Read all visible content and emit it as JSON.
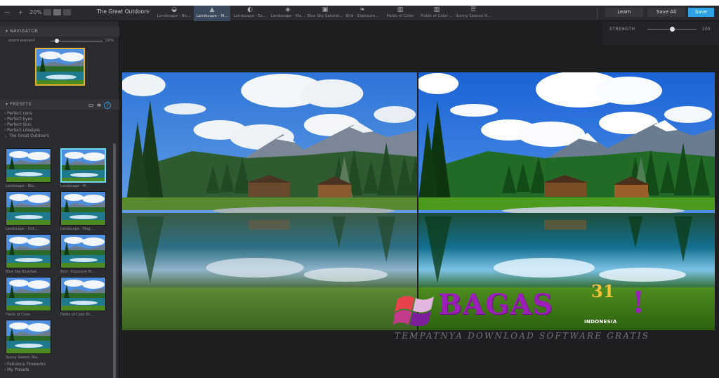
{
  "toolbar": {
    "zoom_out": "—",
    "zoom_in": "+",
    "zoom_value": "20%",
    "preset_name": "The Great Outdoors",
    "tabs": [
      {
        "label": "Landscape - Blu...",
        "icon": "eye-icon"
      },
      {
        "label": "Landscape - M...",
        "icon": "mountain-icon"
      },
      {
        "label": "Landscape - Ex...",
        "icon": "sun-icon"
      },
      {
        "label": "Landscape - Ma...",
        "icon": "compass-icon"
      },
      {
        "label": "Blue Sky Saturat...",
        "icon": "camera-icon"
      },
      {
        "label": "Bird - Exposure...",
        "icon": "leaf-icon"
      },
      {
        "label": "Fields of Color",
        "icon": "chart-icon"
      },
      {
        "label": "Fields of Color ...",
        "icon": "chart-icon"
      },
      {
        "label": "Sunny Season B...",
        "icon": "sliders-icon"
      }
    ],
    "learn_label": "Learn",
    "save_all_label": "Save All",
    "save_label": "Save"
  },
  "strength": {
    "label": "STRENGTH",
    "value": "100"
  },
  "navigator": {
    "title": "NAVIGATOR",
    "zoom_label": "zoom percent",
    "zoom_value": "20%"
  },
  "presets": {
    "title": "PRESETS",
    "groups": [
      "Perfect Lens",
      "Perfect Eyes",
      "Perfect Skin",
      "Perfect Lifestyle",
      "The Great Outdoors"
    ],
    "tiles": [
      "Landscape - Blu...",
      "Landscape - M...",
      "Landscape - Dut...",
      "Landscape - Mag...",
      "Blue Sky Blue/Sat...",
      "Bird - Exposure Bl...",
      "Fields of Color",
      "Fields of Color Bl...",
      "Sunny Season Blu..."
    ],
    "after_groups": [
      "Fabulous Fireworks",
      "My Presets"
    ]
  },
  "watermark": {
    "brand": "BAGAS",
    "number": "31",
    "exclaim": "!",
    "country": "INDONESIA",
    "tagline": "TEMPATNYA DOWNLOAD SOFTWARE GRATIS"
  }
}
